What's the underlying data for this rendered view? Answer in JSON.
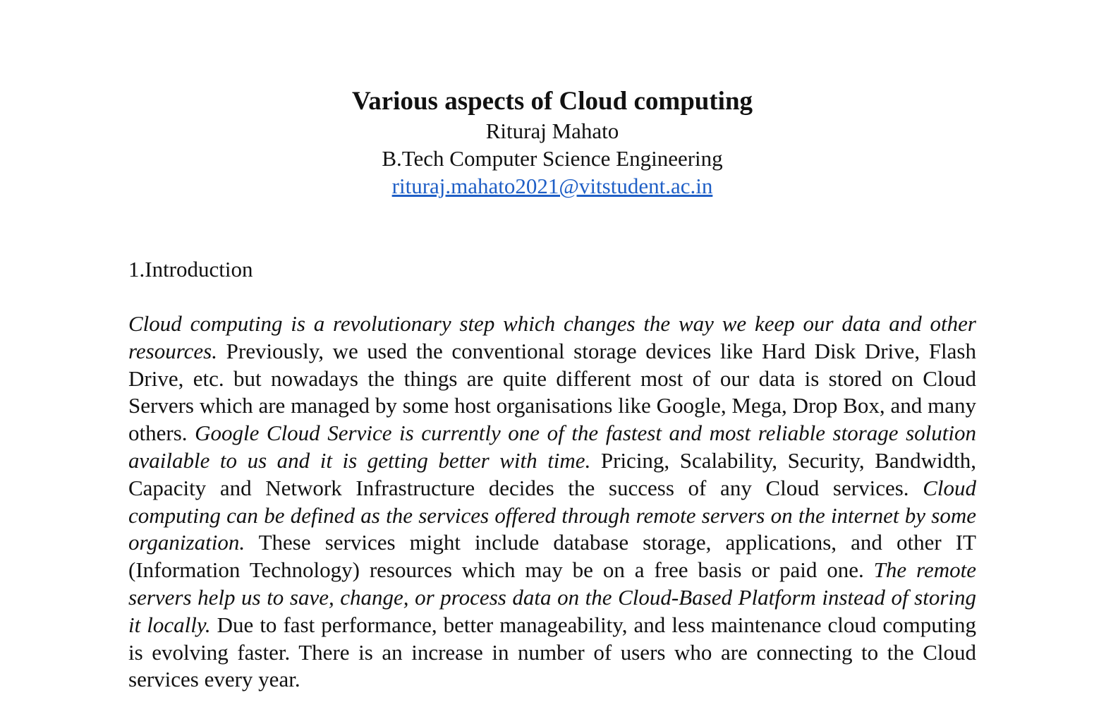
{
  "document": {
    "title": "Various aspects of Cloud computing",
    "author": "Rituraj Mahato",
    "affiliation": "B.Tech Computer Science Engineering",
    "email": "rituraj.mahato2021@vitstudent.ac.in"
  },
  "section": {
    "heading": "1.Introduction",
    "paragraph": [
      {
        "italic": true,
        "text": "Cloud computing is a revolutionary step which changes the way we keep our data and other resources."
      },
      {
        "italic": false,
        "text": " Previously, we used the conventional storage devices like Hard Disk Drive, Flash Drive, etc. but nowadays the things are quite different most of our data is stored on Cloud Servers which are managed by some host organisations like Google, Mega, Drop Box, and many others. "
      },
      {
        "italic": true,
        "text": "Google Cloud Service is currently one of the fastest and most reliable storage solution available to us and it is getting better with time."
      },
      {
        "italic": false,
        "text": " Pricing, Scalability, Security, Bandwidth, Capacity and Network Infrastructure decides the success of any Cloud services. "
      },
      {
        "italic": true,
        "text": "Cloud computing can be defined as the services offered through remote servers on the internet by some organization."
      },
      {
        "italic": false,
        "text": " These services might include database storage, applications, and other IT (Information Technology) resources which may be on a free basis or paid one. "
      },
      {
        "italic": true,
        "text": "The remote servers help us to save, change, or process data on the Cloud-Based Platform instead of storing it locally."
      },
      {
        "italic": false,
        "text": " Due to fast performance, better manageability, and less maintenance cloud computing is evolving faster. There is an increase in number of users who are connecting to the Cloud services every year."
      }
    ]
  },
  "colors": {
    "link": "#1f5fc6",
    "text": "#111111",
    "background": "#ffffff"
  }
}
